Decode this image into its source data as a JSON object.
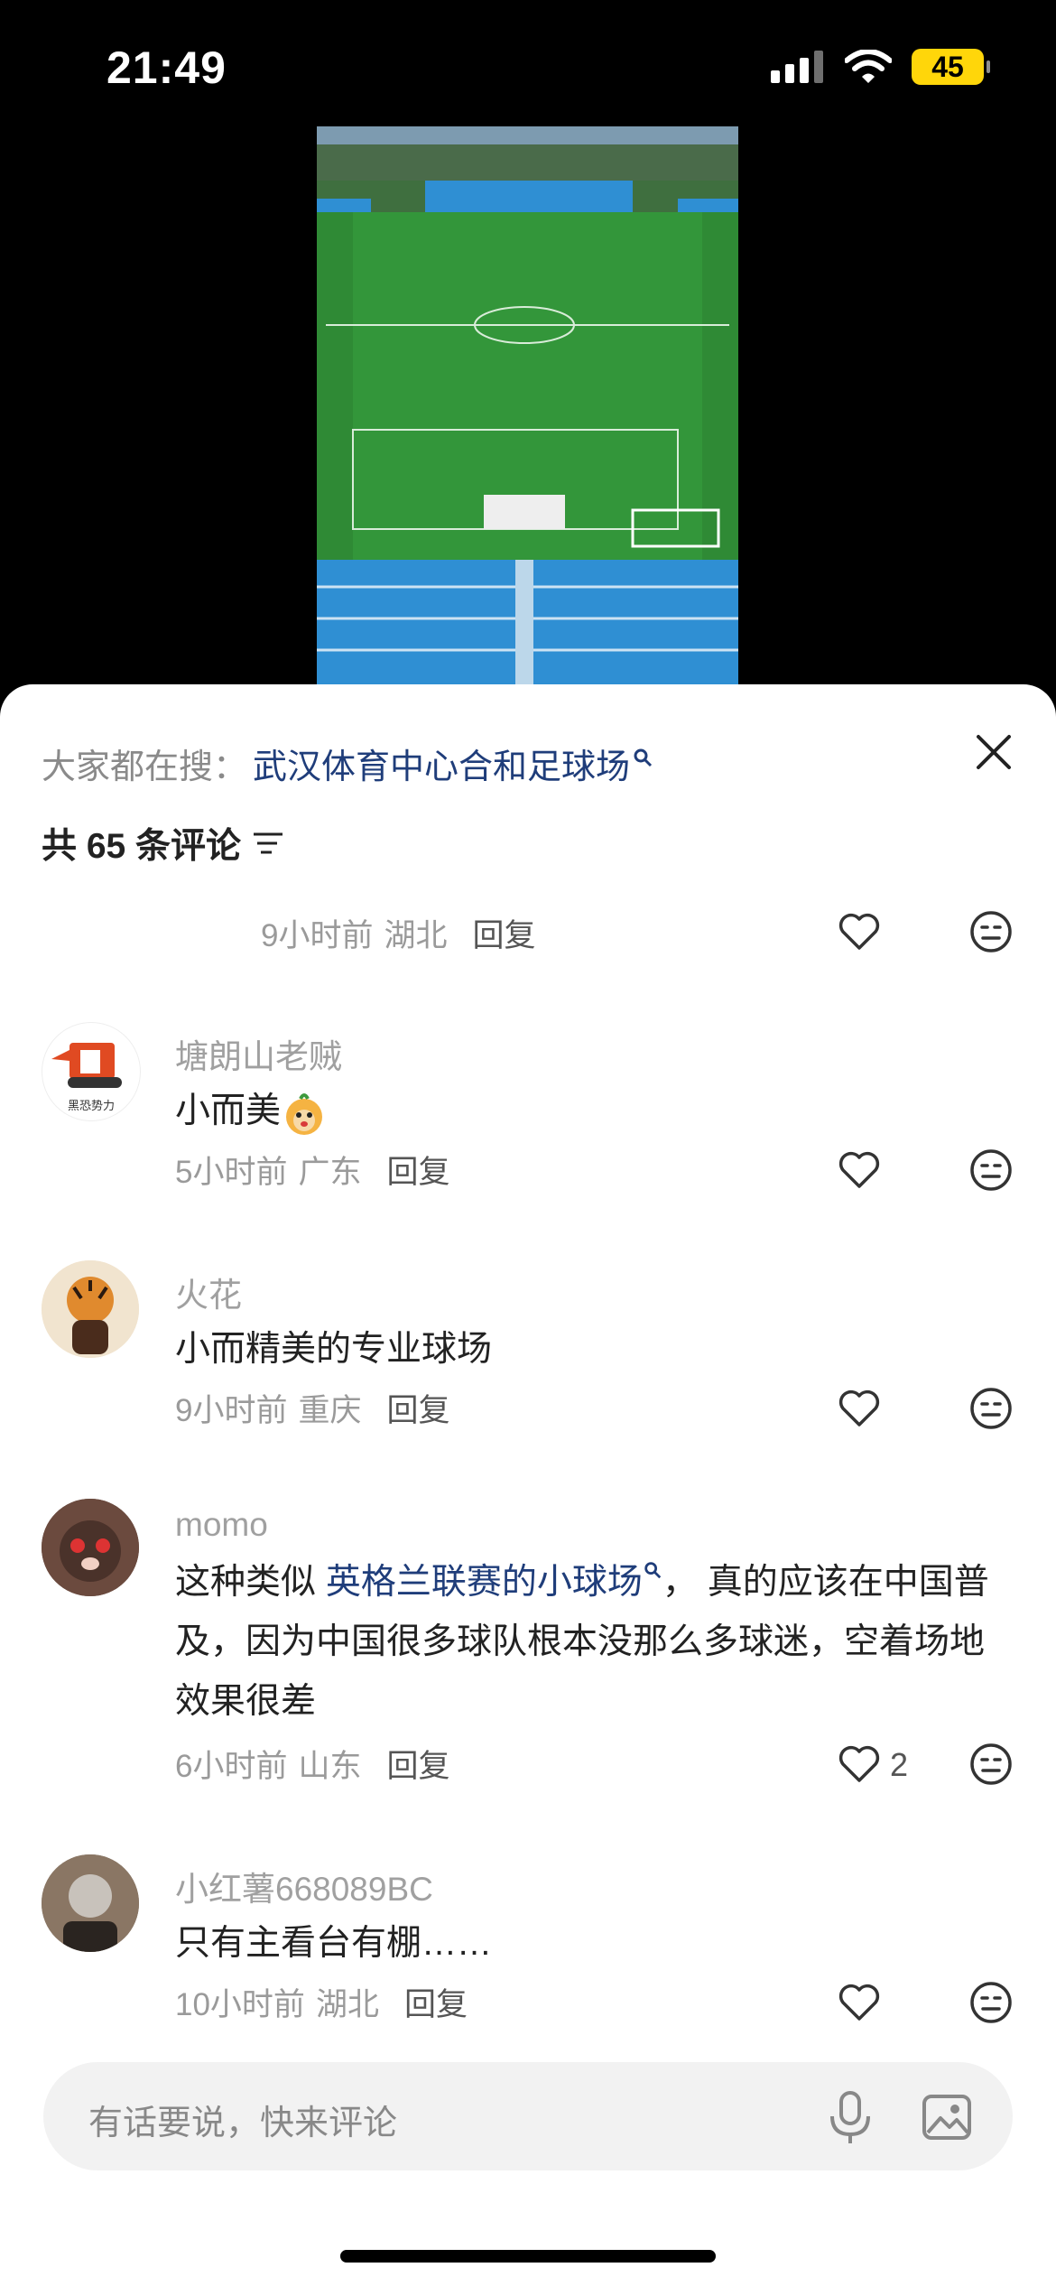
{
  "status_bar": {
    "time": "21:49",
    "battery": "45"
  },
  "panel": {
    "search_prefix": "大家都在搜：",
    "search_term": "武汉体育中心合和足球场",
    "count_text": "共 65 条评论"
  },
  "comments": [
    {
      "time": "9小时前",
      "location": "湖北",
      "reply": "回复"
    },
    {
      "user": "塘朗山老贼",
      "text": "小而美",
      "time": "5小时前",
      "location": "广东",
      "reply": "回复"
    },
    {
      "user": "火花",
      "text": "小而精美的专业球场",
      "time": "9小时前",
      "location": "重庆",
      "reply": "回复"
    },
    {
      "user": "momo",
      "text_before": "这种类似 ",
      "text_link": "英格兰联赛的小球场",
      "text_after": "， 真的应该在中国普及，因为中国很多球队根本没那么多球迷，空着场地效果很差",
      "time": "6小时前",
      "location": "山东",
      "reply": "回复",
      "likes": "2"
    },
    {
      "user": "小红薯668089BC",
      "text": "只有主看台有棚……",
      "time": "10小时前",
      "location": "湖北",
      "reply": "回复"
    }
  ],
  "input": {
    "placeholder": "有话要说，快来评论"
  },
  "avatar_texts": {
    "comment1": "黑恐势力"
  }
}
